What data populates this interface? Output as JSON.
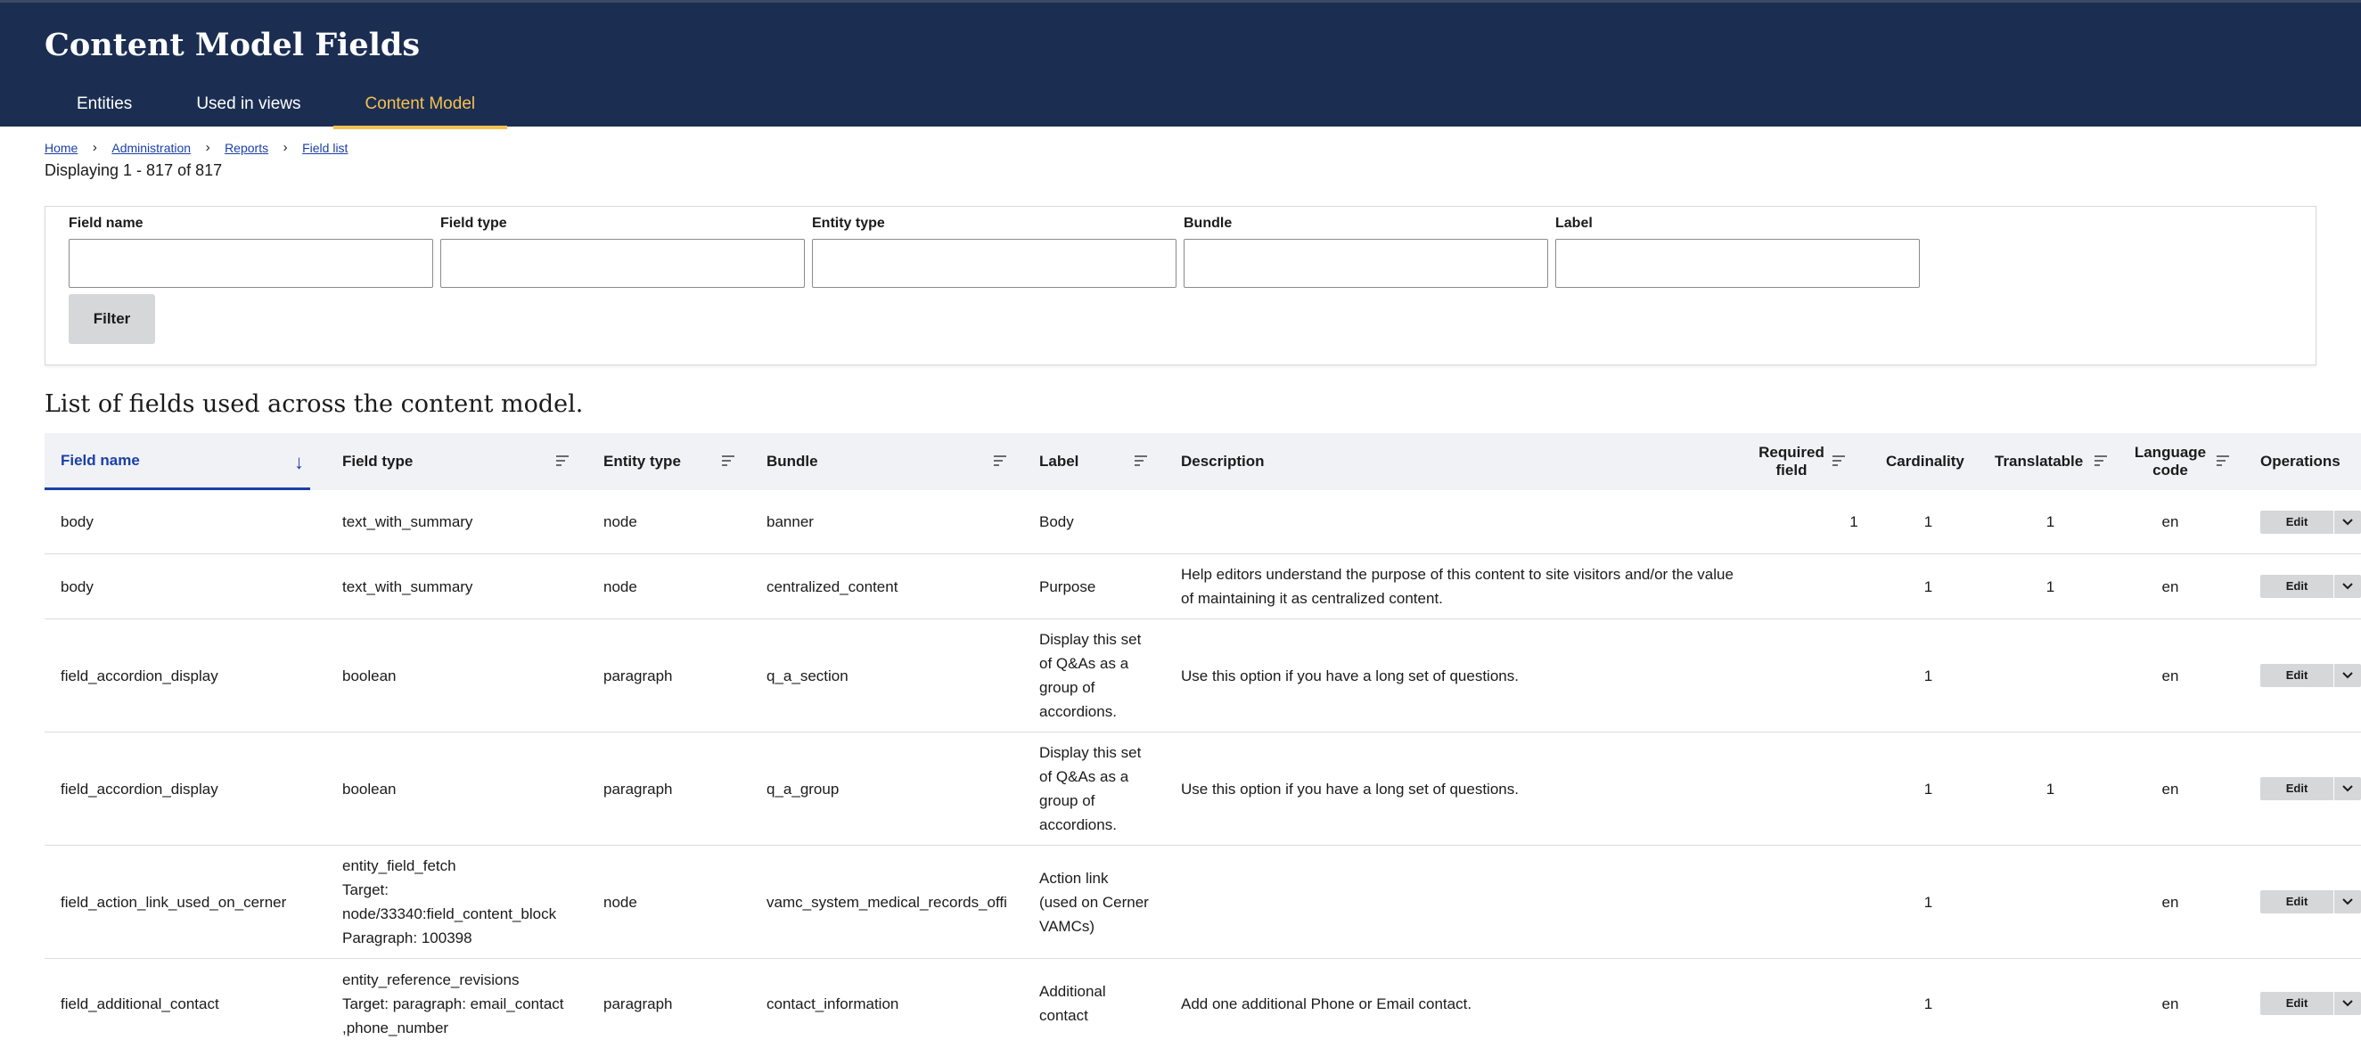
{
  "header": {
    "title": "Content Model Fields",
    "tabs": [
      {
        "label": "Entities"
      },
      {
        "label": "Used in views"
      },
      {
        "label": "Content Model"
      }
    ]
  },
  "breadcrumb": [
    "Home",
    "Administration",
    "Reports",
    "Field list"
  ],
  "breadcrumb_separator": "›",
  "displaying": "Displaying 1 - 817 of 817",
  "filters": {
    "fields": [
      "Field name",
      "Field type",
      "Entity type",
      "Bundle",
      "Label"
    ],
    "button": "Filter"
  },
  "list_heading": "List of fields used across the content model.",
  "table": {
    "columns": [
      "Field name",
      "Field type",
      "Entity type",
      "Bundle",
      "Label",
      "Description",
      "Required field",
      "Cardinality",
      "Translatable",
      "Language code",
      "Operations"
    ],
    "sorted_column": "Field name",
    "rows": [
      {
        "field_name": "body",
        "field_type": "text_with_summary",
        "entity_type": "node",
        "bundle": "banner",
        "label": "Body",
        "description": "",
        "required": "1",
        "cardinality": "1",
        "translatable": "1",
        "language": "en",
        "op": "Edit"
      },
      {
        "field_name": "body",
        "field_type": "text_with_summary",
        "entity_type": "node",
        "bundle": "centralized_content",
        "label": "Purpose",
        "description": "Help editors understand the purpose of this content to site visitors and/or the value\nof maintaining it as centralized content.",
        "required": "",
        "cardinality": "1",
        "translatable": "1",
        "language": "en",
        "op": "Edit"
      },
      {
        "field_name": "field_accordion_display",
        "field_type": "boolean",
        "entity_type": "paragraph",
        "bundle": "q_a_section",
        "label": "Display this set\nof Q&As as a\ngroup of\naccordions.",
        "description": "Use this option if you have a long set of questions.",
        "required": "",
        "cardinality": "1",
        "translatable": "",
        "language": "en",
        "op": "Edit"
      },
      {
        "field_name": "field_accordion_display",
        "field_type": "boolean",
        "entity_type": "paragraph",
        "bundle": "q_a_group",
        "label": "Display this set\nof Q&As as a\ngroup of\naccordions.",
        "description": "Use this option if you have a long set of questions.",
        "required": "",
        "cardinality": "1",
        "translatable": "1",
        "language": "en",
        "op": "Edit"
      },
      {
        "field_name": "field_action_link_used_on_cerner",
        "field_type": "entity_field_fetch\nTarget:\nnode/33340:field_content_block\nParagraph: 100398",
        "entity_type": "node",
        "bundle": "vamc_system_medical_records_offi",
        "label": "Action link\n(used on Cerner\nVAMCs)",
        "description": "",
        "required": "",
        "cardinality": "1",
        "translatable": "",
        "language": "en",
        "op": "Edit"
      },
      {
        "field_name": "field_additional_contact",
        "field_type": "entity_reference_revisions\nTarget: paragraph: email_contact\n,phone_number",
        "entity_type": "paragraph",
        "bundle": "contact_information",
        "label": "Additional\ncontact",
        "description": "Add one additional Phone or Email contact.",
        "required": "",
        "cardinality": "1",
        "translatable": "",
        "language": "en",
        "op": "Edit"
      }
    ]
  }
}
